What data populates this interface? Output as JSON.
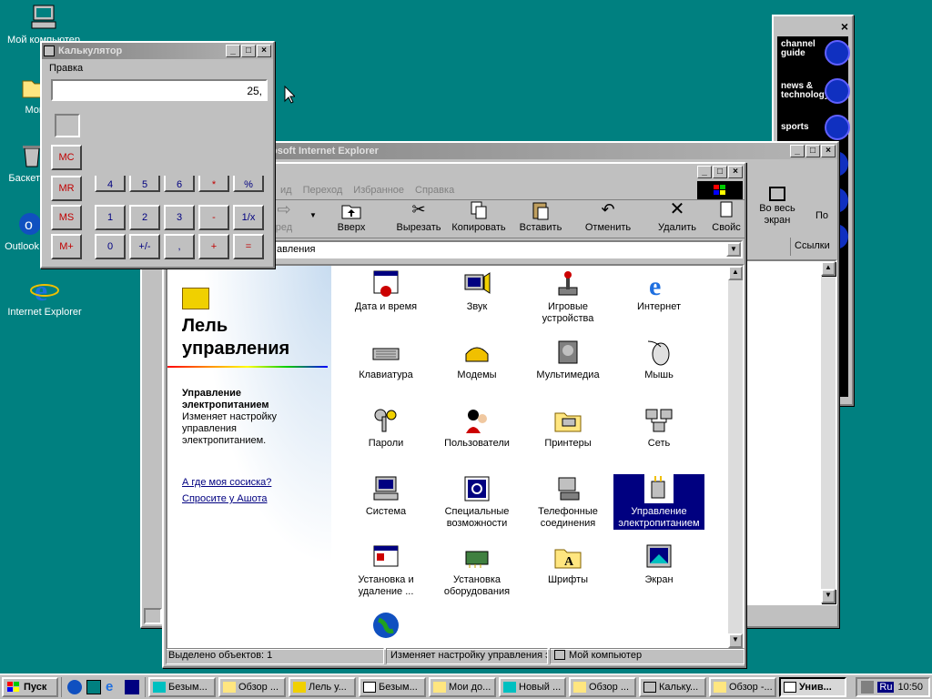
{
  "desktop": {
    "icons": [
      {
        "label": "Мой компьютер"
      },
      {
        "label": "Мои"
      },
      {
        "label": "Баскет"
      },
      {
        "label": "Outlook"
      },
      {
        "label": "Internet Explorer"
      }
    ]
  },
  "calculator": {
    "title": "Калькулятор",
    "menu": "Правка",
    "display": "25,",
    "buttons": [
      "MC",
      "MR",
      "MS",
      "M+",
      "4",
      "5",
      "6",
      "*",
      "%",
      "1",
      "2",
      "3",
      "-",
      "1/x",
      "0",
      "+/-",
      ",",
      "+",
      "="
    ]
  },
  "back_window": {
    "title": "osoft Internet Explorer",
    "toolbar": [
      "Во весь экран",
      "По"
    ],
    "address_suffix": "Ссылки"
  },
  "explorer": {
    "menu": [
      "ид",
      "Переход",
      "Избранное",
      "Справка"
    ],
    "toolbar": [
      "ред",
      "Вверх",
      "Вырезать",
      "Копировать",
      "Вставить",
      "Отменить",
      "Удалить",
      "Свойс"
    ],
    "address": "авления",
    "panel_title": "Лель управления",
    "selected_title": "Управление электропитанием",
    "selected_desc": "Изменяет настройку управления электропитанием.",
    "links": [
      "А где моя сосиска?",
      "Спросите у Ашота"
    ],
    "items": [
      "Дата и время",
      "Звук",
      "Игровые устройства",
      "Интернет",
      "Клавиатура",
      "Модемы",
      "Мультимедиа",
      "Мышь",
      "Пароли",
      "Пользователи",
      "Принтеры",
      "Сеть",
      "Система",
      "Специальные возможности",
      "Телефонные соединения",
      "Управление электропитанием",
      "Установка и удаление ...",
      "Установка оборудования",
      "Шрифты",
      "Экран"
    ],
    "status": [
      "Выделено объектов: 1",
      "Изменяет настройку управления э",
      "Мой компьютер"
    ]
  },
  "channel_bar": {
    "items": [
      "channel guide",
      "news & technology",
      "sports"
    ]
  },
  "taskbar": {
    "start": "Пуск",
    "tasks": [
      "Безым...",
      "Обзор ...",
      "Лель у...",
      "Безым...",
      "Мои до...",
      "Новый ...",
      "Обзор ...",
      "Кальку...",
      "Обзор -...",
      "Унив..."
    ],
    "lang": "Ru",
    "time": "10:50"
  },
  "colors": {
    "desktop": "#008080",
    "title_active": "#000080",
    "face": "#c0c0c0"
  }
}
